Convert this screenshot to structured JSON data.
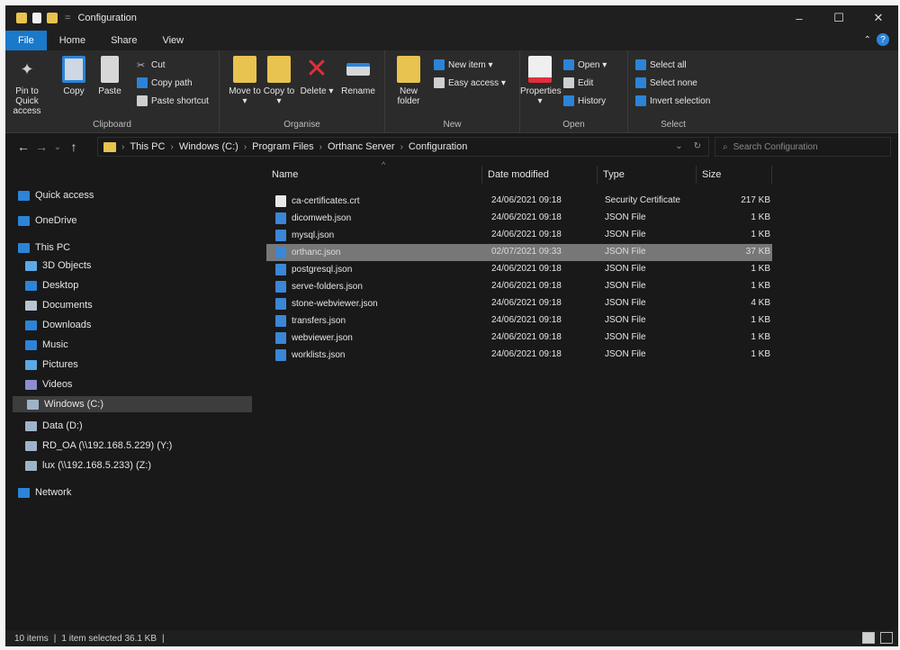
{
  "window": {
    "title": "Configuration",
    "controls": [
      "–",
      "☐",
      "✕"
    ]
  },
  "quick_access_separator": "=",
  "menu": {
    "tabs": [
      "File",
      "Home",
      "Share",
      "View"
    ],
    "collapse_glyph": "⌃",
    "help_glyph": "?"
  },
  "ribbon": {
    "clipboard": {
      "label": "Clipboard",
      "pin_label": "Pin to Quick access",
      "copy_label": "Copy",
      "paste_label": "Paste",
      "cut_label": "Cut",
      "copy_path_label": "Copy path",
      "paste_shortcut_label": "Paste shortcut"
    },
    "organise": {
      "label": "Organise",
      "move_to_label": "Move to ▾",
      "copy_to_label": "Copy to ▾",
      "delete_label": "Delete ▾",
      "rename_label": "Rename"
    },
    "new": {
      "label": "New",
      "new_folder_label": "New folder",
      "new_item_label": "New item ▾",
      "easy_access_label": "Easy access ▾"
    },
    "open": {
      "label": "Open",
      "properties_label": "Properties ▾",
      "open_label": "Open ▾",
      "edit_label": "Edit",
      "history_label": "History"
    },
    "select": {
      "label": "Select",
      "select_all_label": "Select all",
      "select_none_label": "Select none",
      "invert_label": "Invert selection"
    }
  },
  "address": {
    "back_glyph": "←",
    "forward_glyph": "→",
    "recent_glyph": "⌄",
    "up_glyph": "↑",
    "separator": "›",
    "crumbs": [
      "This PC",
      "Windows (C:)",
      "Program Files",
      "Orthanc Server",
      "Configuration"
    ],
    "dropdown_glyph": "⌄",
    "refresh_glyph": "↻",
    "search_placeholder": "Search Configuration"
  },
  "nav": {
    "items": [
      {
        "label": "Quick access",
        "color": "#2b84d8"
      },
      {
        "label": "OneDrive",
        "color": "#2b84d8"
      },
      {
        "label": "This PC",
        "color": "#2b84d8"
      },
      {
        "label": "3D Objects",
        "color": "#5aa9e6"
      },
      {
        "label": "Desktop",
        "color": "#2b84d8"
      },
      {
        "label": "Documents",
        "color": "#b9c4d2"
      },
      {
        "label": "Downloads",
        "color": "#2b84d8"
      },
      {
        "label": "Music",
        "color": "#2b84d8"
      },
      {
        "label": "Pictures",
        "color": "#5aa9e6"
      },
      {
        "label": "Videos",
        "color": "#8a8fd0"
      },
      {
        "label": "Windows (C:)",
        "color": "#9fb3c8"
      },
      {
        "label": "Data (D:)",
        "color": "#9fb3c8"
      },
      {
        "label": "RD_OA (\\\\192.168.5.229) (Y:)",
        "color": "#9fb3c8"
      },
      {
        "label": "lux (\\\\192.168.5.233) (Z:)",
        "color": "#9fb3c8"
      },
      {
        "label": "Network",
        "color": "#2b84d8"
      }
    ]
  },
  "list": {
    "sort_glyph": "^",
    "columns": {
      "name": "Name",
      "date": "Date modified",
      "type": "Type",
      "size": "Size"
    },
    "rows": [
      {
        "name": "ca-certificates.crt",
        "date": "24/06/2021 09:18",
        "type": "Security Certificate",
        "size": "217 KB",
        "icon": "certificate"
      },
      {
        "name": "dicomweb.json",
        "date": "24/06/2021 09:18",
        "type": "JSON File",
        "size": "1 KB",
        "icon": "json"
      },
      {
        "name": "mysql.json",
        "date": "24/06/2021 09:18",
        "type": "JSON File",
        "size": "1 KB",
        "icon": "json"
      },
      {
        "name": "orthanc.json",
        "date": "02/07/2021 09:33",
        "type": "JSON File",
        "size": "37 KB",
        "icon": "json"
      },
      {
        "name": "postgresql.json",
        "date": "24/06/2021 09:18",
        "type": "JSON File",
        "size": "1 KB",
        "icon": "json"
      },
      {
        "name": "serve-folders.json",
        "date": "24/06/2021 09:18",
        "type": "JSON File",
        "size": "1 KB",
        "icon": "json"
      },
      {
        "name": "stone-webviewer.json",
        "date": "24/06/2021 09:18",
        "type": "JSON File",
        "size": "4 KB",
        "icon": "json"
      },
      {
        "name": "transfers.json",
        "date": "24/06/2021 09:18",
        "type": "JSON File",
        "size": "1 KB",
        "icon": "json"
      },
      {
        "name": "webviewer.json",
        "date": "24/06/2021 09:18",
        "type": "JSON File",
        "size": "1 KB",
        "icon": "json"
      },
      {
        "name": "worklists.json",
        "date": "24/06/2021 09:18",
        "type": "JSON File",
        "size": "1 KB",
        "icon": "json"
      }
    ]
  },
  "status": {
    "count": "10 items",
    "selected": "1 item selected  36.1 KB"
  },
  "colors": {
    "accent": "#1979ca",
    "selected_row": "#777777",
    "background": "#191919"
  }
}
